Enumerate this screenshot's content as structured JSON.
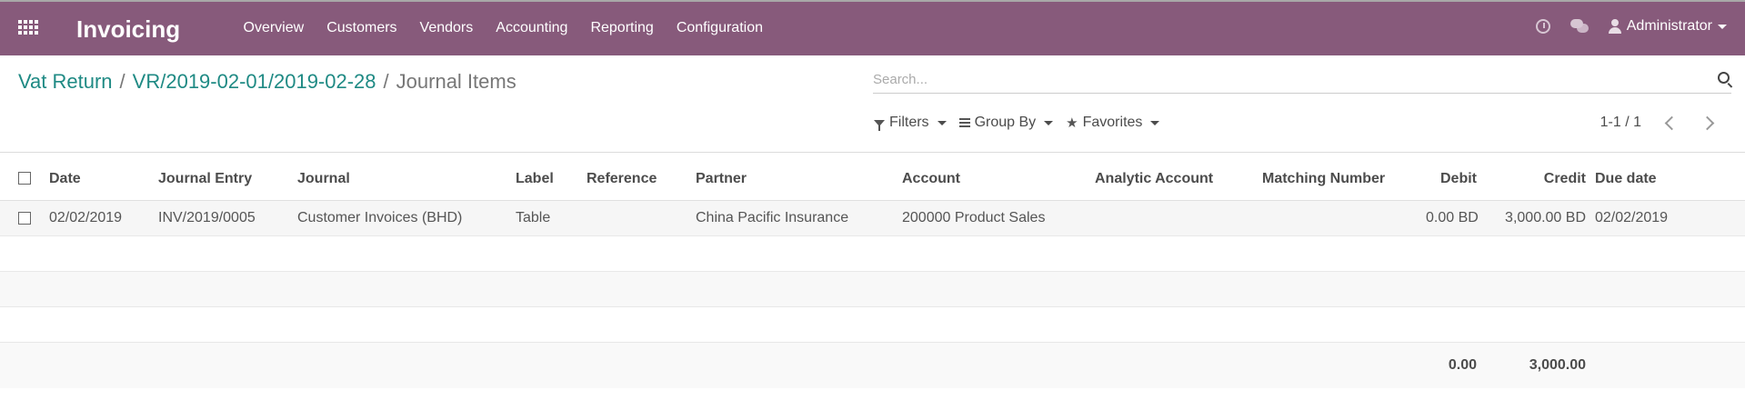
{
  "app": {
    "title": "Invoicing",
    "menu": [
      "Overview",
      "Customers",
      "Vendors",
      "Accounting",
      "Reporting",
      "Configuration"
    ],
    "user": "Administrator",
    "brand_color": "#875a7b"
  },
  "breadcrumb": {
    "items": [
      "Vat Return",
      "VR/2019-02-01/2019-02-28"
    ],
    "separator": "/",
    "current": "Journal Items"
  },
  "search": {
    "placeholder": "Search..."
  },
  "filters": {
    "filters": "Filters",
    "group_by": "Group By",
    "favorites": "Favorites"
  },
  "pager": {
    "text": "1-1 / 1"
  },
  "table": {
    "columns": [
      "Date",
      "Journal Entry",
      "Journal",
      "Label",
      "Reference",
      "Partner",
      "Account",
      "Analytic Account",
      "Matching Number",
      "Debit",
      "Credit",
      "Due date"
    ],
    "rows": [
      {
        "date": "02/02/2019",
        "journal_entry": "INV/2019/0005",
        "journal": "Customer Invoices (BHD)",
        "label": "Table",
        "reference": "",
        "partner": "China Pacific Insurance",
        "account": "200000 Product Sales",
        "analytic_account": "",
        "matching_number": "",
        "debit": "0.00 BD",
        "credit": "3,000.00 BD",
        "due_date": "02/02/2019"
      }
    ],
    "totals": {
      "debit": "0.00",
      "credit": "3,000.00"
    }
  }
}
